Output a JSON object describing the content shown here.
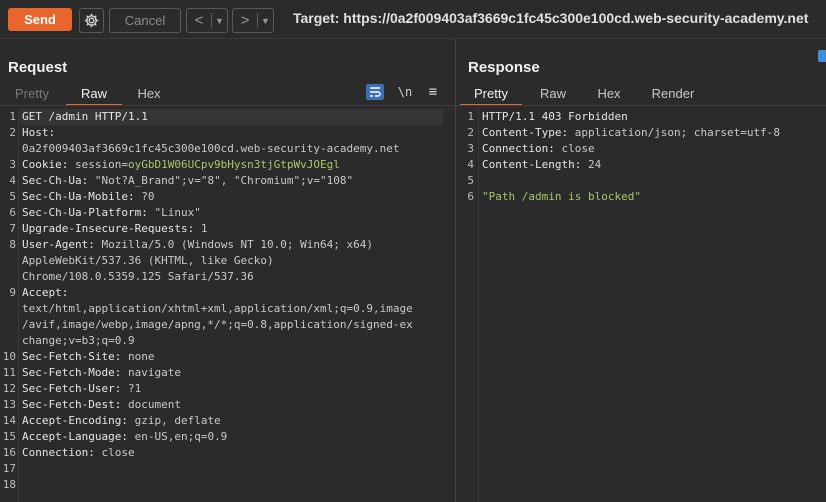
{
  "toolbar": {
    "send_label": "Send",
    "cancel_label": "Cancel",
    "back_arrow": "<",
    "forward_arrow": ">",
    "dropdown_glyph": "▼",
    "target_text": "Target: https://0a2f009403af3669c1fc45c300e100cd.web-security-academy.net"
  },
  "request": {
    "title": "Request",
    "tabs": [
      "Pretty",
      "Raw",
      "Hex"
    ],
    "active_tab": "Raw",
    "tools": [
      "wrap-icon",
      "\\n",
      "≡"
    ],
    "lines": [
      {
        "n": "1",
        "parts": [
          {
            "t": "GET /admin HTTP/1.1",
            "c": "k"
          }
        ]
      },
      {
        "n": "2",
        "parts": [
          {
            "t": "Host:",
            "c": "k"
          }
        ]
      },
      {
        "n": "",
        "parts": [
          {
            "t": "0a2f009403af3669c1fc45c300e100cd.web-security-academy.net",
            "c": "v"
          }
        ]
      },
      {
        "n": "3",
        "parts": [
          {
            "t": "Cookie: ",
            "c": "k"
          },
          {
            "t": "session=",
            "c": "v"
          },
          {
            "t": "oyGbD1W06UCpv9bHysn3tjGtpWvJOEgl",
            "c": "cookie"
          }
        ]
      },
      {
        "n": "4",
        "parts": [
          {
            "t": "Sec-Ch-Ua: ",
            "c": "k"
          },
          {
            "t": "\"Not?A_Brand\";v=\"8\", \"Chromium\";v=\"108\"",
            "c": "v"
          }
        ]
      },
      {
        "n": "5",
        "parts": [
          {
            "t": "Sec-Ch-Ua-Mobile: ",
            "c": "k"
          },
          {
            "t": "?0",
            "c": "v"
          }
        ]
      },
      {
        "n": "6",
        "parts": [
          {
            "t": "Sec-Ch-Ua-Platform: ",
            "c": "k"
          },
          {
            "t": "\"Linux\"",
            "c": "v"
          }
        ]
      },
      {
        "n": "7",
        "parts": [
          {
            "t": "Upgrade-Insecure-Requests: ",
            "c": "k"
          },
          {
            "t": "1",
            "c": "v"
          }
        ]
      },
      {
        "n": "8",
        "parts": [
          {
            "t": "User-Agent: ",
            "c": "k"
          },
          {
            "t": "Mozilla/5.0 (Windows NT 10.0; Win64; x64)",
            "c": "v"
          }
        ]
      },
      {
        "n": "",
        "parts": [
          {
            "t": "AppleWebKit/537.36 (KHTML, like Gecko)",
            "c": "v"
          }
        ]
      },
      {
        "n": "",
        "parts": [
          {
            "t": "Chrome/108.0.5359.125 Safari/537.36",
            "c": "v"
          }
        ]
      },
      {
        "n": "9",
        "parts": [
          {
            "t": "Accept:",
            "c": "k"
          }
        ]
      },
      {
        "n": "",
        "parts": [
          {
            "t": "text/html,application/xhtml+xml,application/xml;q=0.9,image",
            "c": "v"
          }
        ]
      },
      {
        "n": "",
        "parts": [
          {
            "t": "/avif,image/webp,image/apng,*/*;q=0.8,application/signed-ex",
            "c": "v"
          }
        ]
      },
      {
        "n": "",
        "parts": [
          {
            "t": "change;v=b3;q=0.9",
            "c": "v"
          }
        ]
      },
      {
        "n": "10",
        "parts": [
          {
            "t": "Sec-Fetch-Site: ",
            "c": "k"
          },
          {
            "t": "none",
            "c": "v"
          }
        ]
      },
      {
        "n": "11",
        "parts": [
          {
            "t": "Sec-Fetch-Mode: ",
            "c": "k"
          },
          {
            "t": "navigate",
            "c": "v"
          }
        ]
      },
      {
        "n": "12",
        "parts": [
          {
            "t": "Sec-Fetch-User: ",
            "c": "k"
          },
          {
            "t": "?1",
            "c": "v"
          }
        ]
      },
      {
        "n": "13",
        "parts": [
          {
            "t": "Sec-Fetch-Dest: ",
            "c": "k"
          },
          {
            "t": "document",
            "c": "v"
          }
        ]
      },
      {
        "n": "14",
        "parts": [
          {
            "t": "Accept-Encoding: ",
            "c": "k"
          },
          {
            "t": "gzip, deflate",
            "c": "v"
          }
        ]
      },
      {
        "n": "15",
        "parts": [
          {
            "t": "Accept-Language: ",
            "c": "k"
          },
          {
            "t": "en-US,en;q=0.9",
            "c": "v"
          }
        ]
      },
      {
        "n": "16",
        "parts": [
          {
            "t": "Connection: ",
            "c": "k"
          },
          {
            "t": "close",
            "c": "v"
          }
        ]
      },
      {
        "n": "17",
        "parts": []
      },
      {
        "n": "18",
        "parts": []
      }
    ]
  },
  "response": {
    "title": "Response",
    "tabs": [
      "Pretty",
      "Raw",
      "Hex",
      "Render"
    ],
    "active_tab": "Pretty",
    "lines": [
      {
        "n": "1",
        "parts": [
          {
            "t": "HTTP/1.1 403 Forbidden",
            "c": "k"
          }
        ]
      },
      {
        "n": "2",
        "parts": [
          {
            "t": "Content-Type: ",
            "c": "k"
          },
          {
            "t": "application/json; charset=utf-8",
            "c": "v"
          }
        ]
      },
      {
        "n": "3",
        "parts": [
          {
            "t": "Connection: ",
            "c": "k"
          },
          {
            "t": "close",
            "c": "v"
          }
        ]
      },
      {
        "n": "4",
        "parts": [
          {
            "t": "Content-Length: ",
            "c": "k"
          },
          {
            "t": "24",
            "c": "v"
          }
        ]
      },
      {
        "n": "5",
        "parts": []
      },
      {
        "n": "6",
        "parts": [
          {
            "t": "\"Path /admin is blocked\"",
            "c": "str"
          }
        ]
      }
    ]
  },
  "colors": {
    "accent": "#e8662b",
    "background": "#2b2b2b",
    "cookie_value": "#a6c76a",
    "active_tool": "#3d6fb8"
  }
}
